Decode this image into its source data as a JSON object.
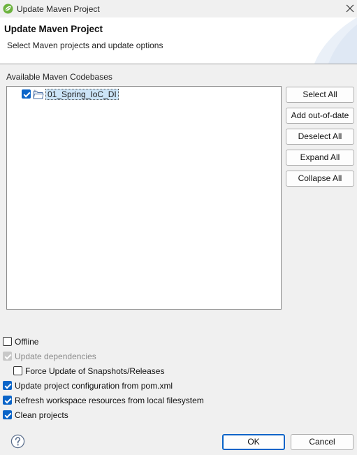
{
  "window": {
    "title": "Update Maven Project",
    "app_icon": "spring-leaf-icon",
    "close_icon": "close-icon"
  },
  "header": {
    "title": "Update Maven Project",
    "subtitle": "Select Maven projects and update options"
  },
  "codebases": {
    "label": "Available Maven Codebases",
    "items": [
      {
        "label": "01_Spring_IoC_DI",
        "checked": true,
        "icon": "maven-project-folder-icon"
      }
    ]
  },
  "side_buttons": {
    "select_all": "Select All",
    "add_out_of_date": "Add out-of-date",
    "deselect_all": "Deselect All",
    "expand_all": "Expand All",
    "collapse_all": "Collapse All"
  },
  "options": {
    "offline": {
      "label": "Offline",
      "checked": false
    },
    "update_dependencies": {
      "label": "Update dependencies",
      "checked": true,
      "disabled": true
    },
    "force_update": {
      "label": "Force Update of Snapshots/Releases",
      "checked": false
    },
    "update_config": {
      "label": "Update project configuration from pom.xml",
      "checked": true
    },
    "refresh_workspace": {
      "label": "Refresh workspace resources from local filesystem",
      "checked": true
    },
    "clean_projects": {
      "label": "Clean projects",
      "checked": true
    }
  },
  "footer": {
    "help_icon": "help-icon",
    "ok": "OK",
    "cancel": "Cancel"
  },
  "colors": {
    "accent": "#0a64c8",
    "selection": "#cce4f7"
  }
}
